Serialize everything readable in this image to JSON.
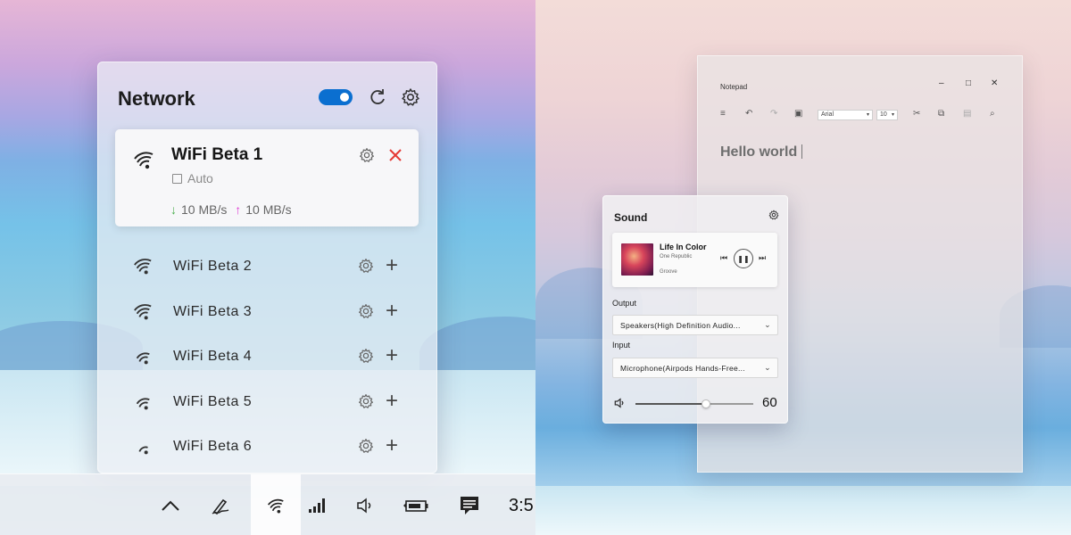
{
  "network": {
    "title": "Network",
    "toggle_on": true,
    "connected": {
      "name": "WiFi Beta 1",
      "auto_label": "Auto",
      "download": "10 MB/s",
      "upload": "10 MB/s"
    },
    "networks": [
      {
        "label": "WiFi Beta 2",
        "signal": 4
      },
      {
        "label": "WiFi Beta 3",
        "signal": 4
      },
      {
        "label": "WiFi Beta 4",
        "signal": 3
      },
      {
        "label": "WiFi Beta 5",
        "signal": 3
      },
      {
        "label": "WiFi Beta 6",
        "signal": 2
      }
    ]
  },
  "taskbar": {
    "clock": "3:5",
    "icons": [
      "chevron-up-icon",
      "pen-icon",
      "wifi-icon",
      "cellular-icon",
      "volume-icon",
      "battery-icon",
      "message-icon"
    ]
  },
  "notepad": {
    "title": "Notepad",
    "font": "Arial",
    "font_size": "10",
    "text": "Hello world"
  },
  "sound": {
    "title": "Sound",
    "media": {
      "song": "Life In Color",
      "artist": "One Republic",
      "app": "Groove"
    },
    "output_label": "Output",
    "output_device": "Speakers(High Definition Audio...",
    "input_label": "Input",
    "input_device": "Microphone(Airpods Hands-Free...",
    "volume": 60,
    "volume_text": "60"
  }
}
